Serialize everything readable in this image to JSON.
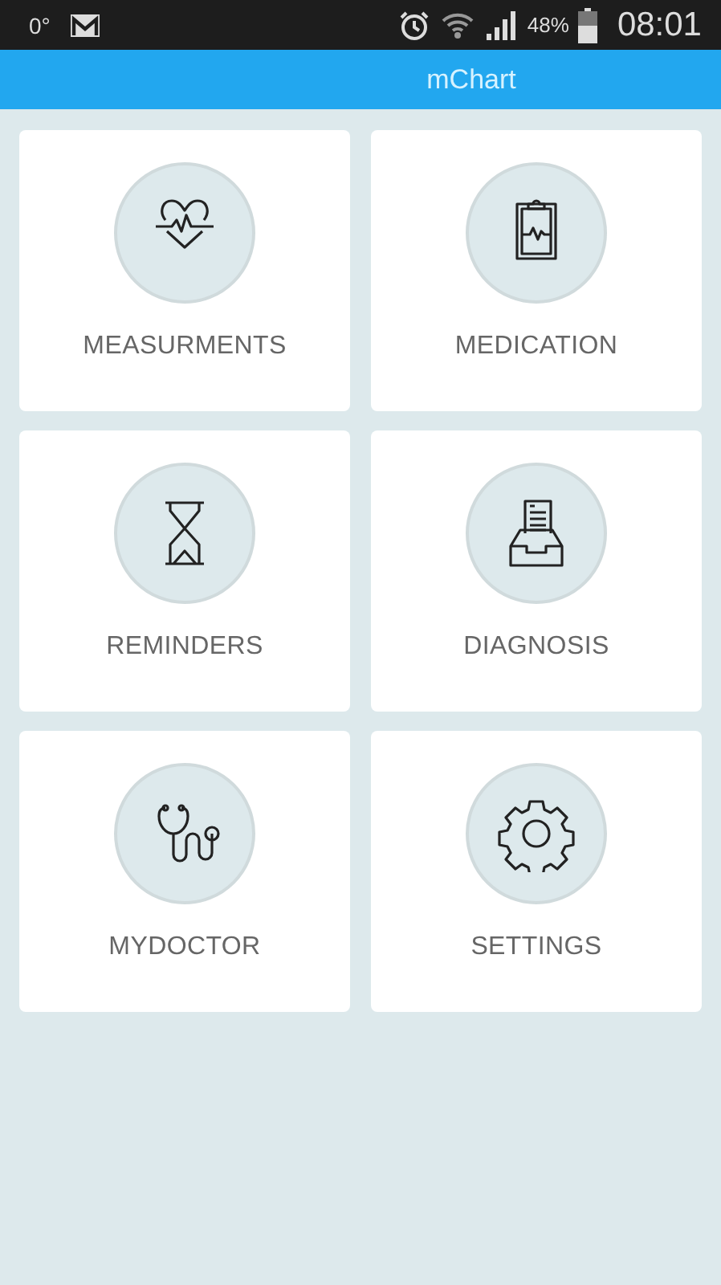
{
  "status_bar": {
    "temperature": "0°",
    "battery_percent": "48%",
    "time": "08:01"
  },
  "app_bar": {
    "title": "mChart"
  },
  "tiles": [
    {
      "label": "MEASURMENTS",
      "kind": "heart"
    },
    {
      "label": "MEDICATION",
      "kind": "clipboard"
    },
    {
      "label": "REMINDERS",
      "kind": "hourglass"
    },
    {
      "label": "DIAGNOSIS",
      "kind": "inbox"
    },
    {
      "label": "MYDOCTOR",
      "kind": "stethoscope"
    },
    {
      "label": "SETTINGS",
      "kind": "gear"
    }
  ]
}
